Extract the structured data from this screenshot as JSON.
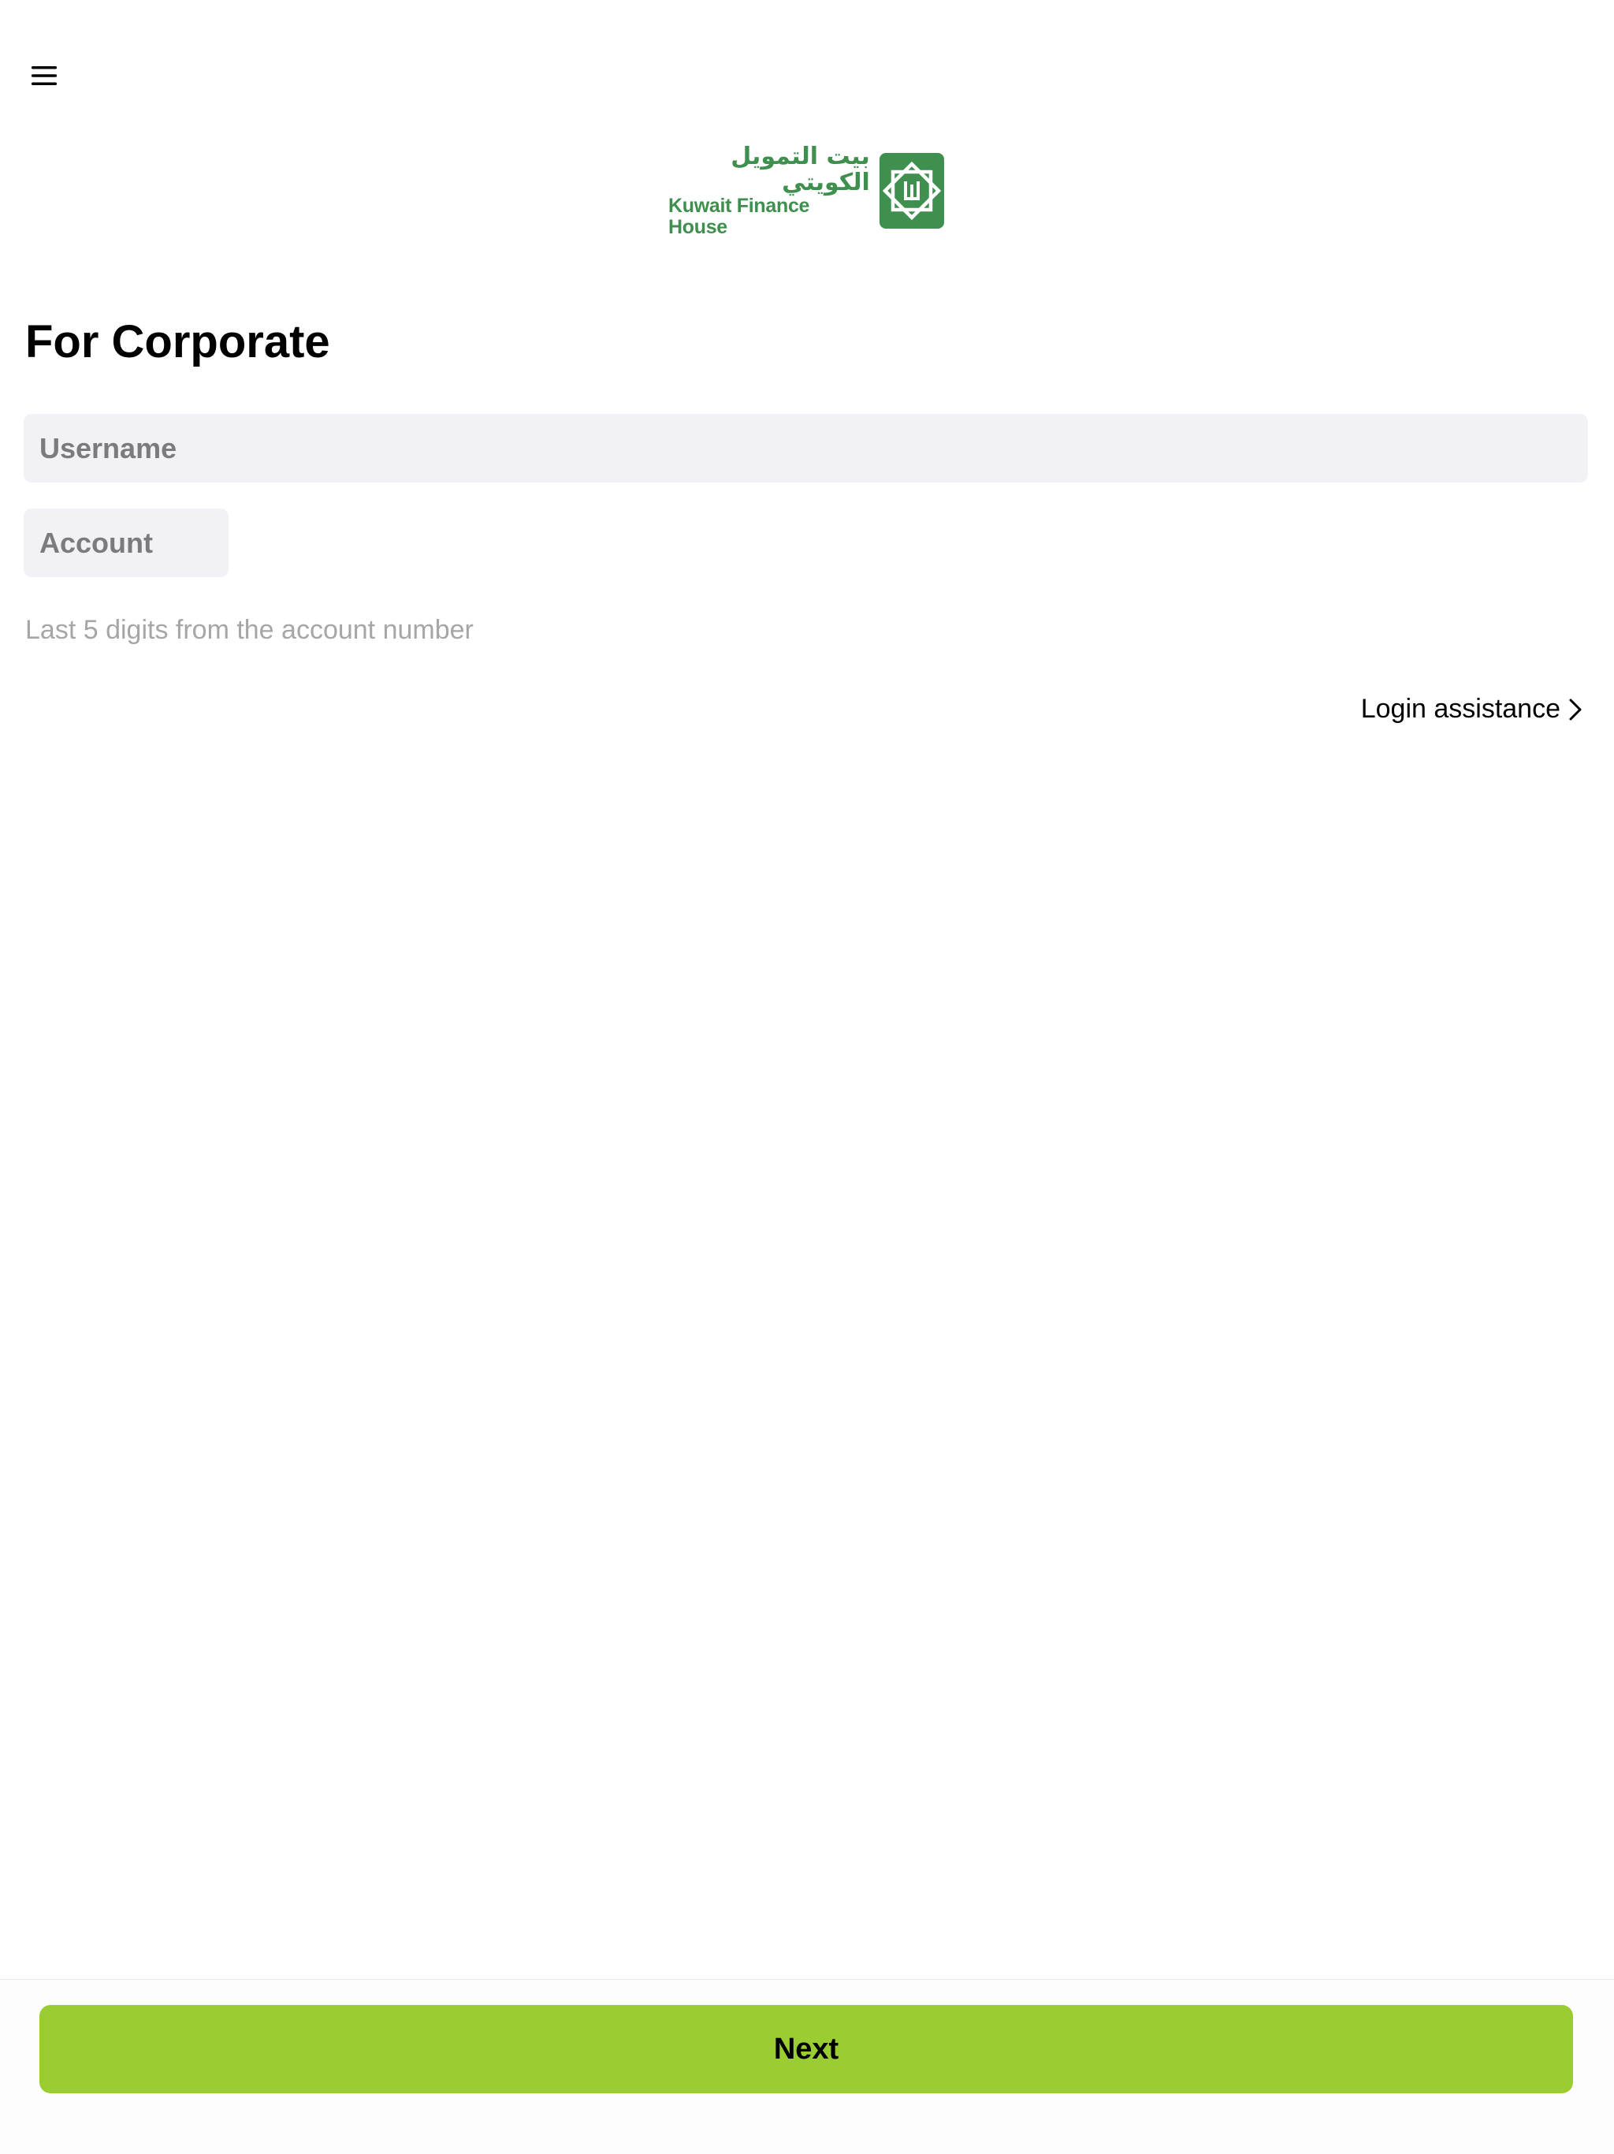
{
  "header": {
    "menu_icon": "hamburger-menu-icon"
  },
  "logo": {
    "arabic_name": "بيت التمويل الكويتي",
    "english_name": "Kuwait Finance House",
    "brand_color": "#3f8f4f"
  },
  "form": {
    "title": "For Corporate",
    "username_placeholder": "Username",
    "username_value": "",
    "account_placeholder": "Account",
    "account_value": "",
    "account_hint": "Last 5 digits from the account number",
    "login_assistance_label": "Login assistance",
    "login_assistance_icon": "chevron-right-icon"
  },
  "footer": {
    "next_label": "Next",
    "next_color": "#9acd32"
  }
}
